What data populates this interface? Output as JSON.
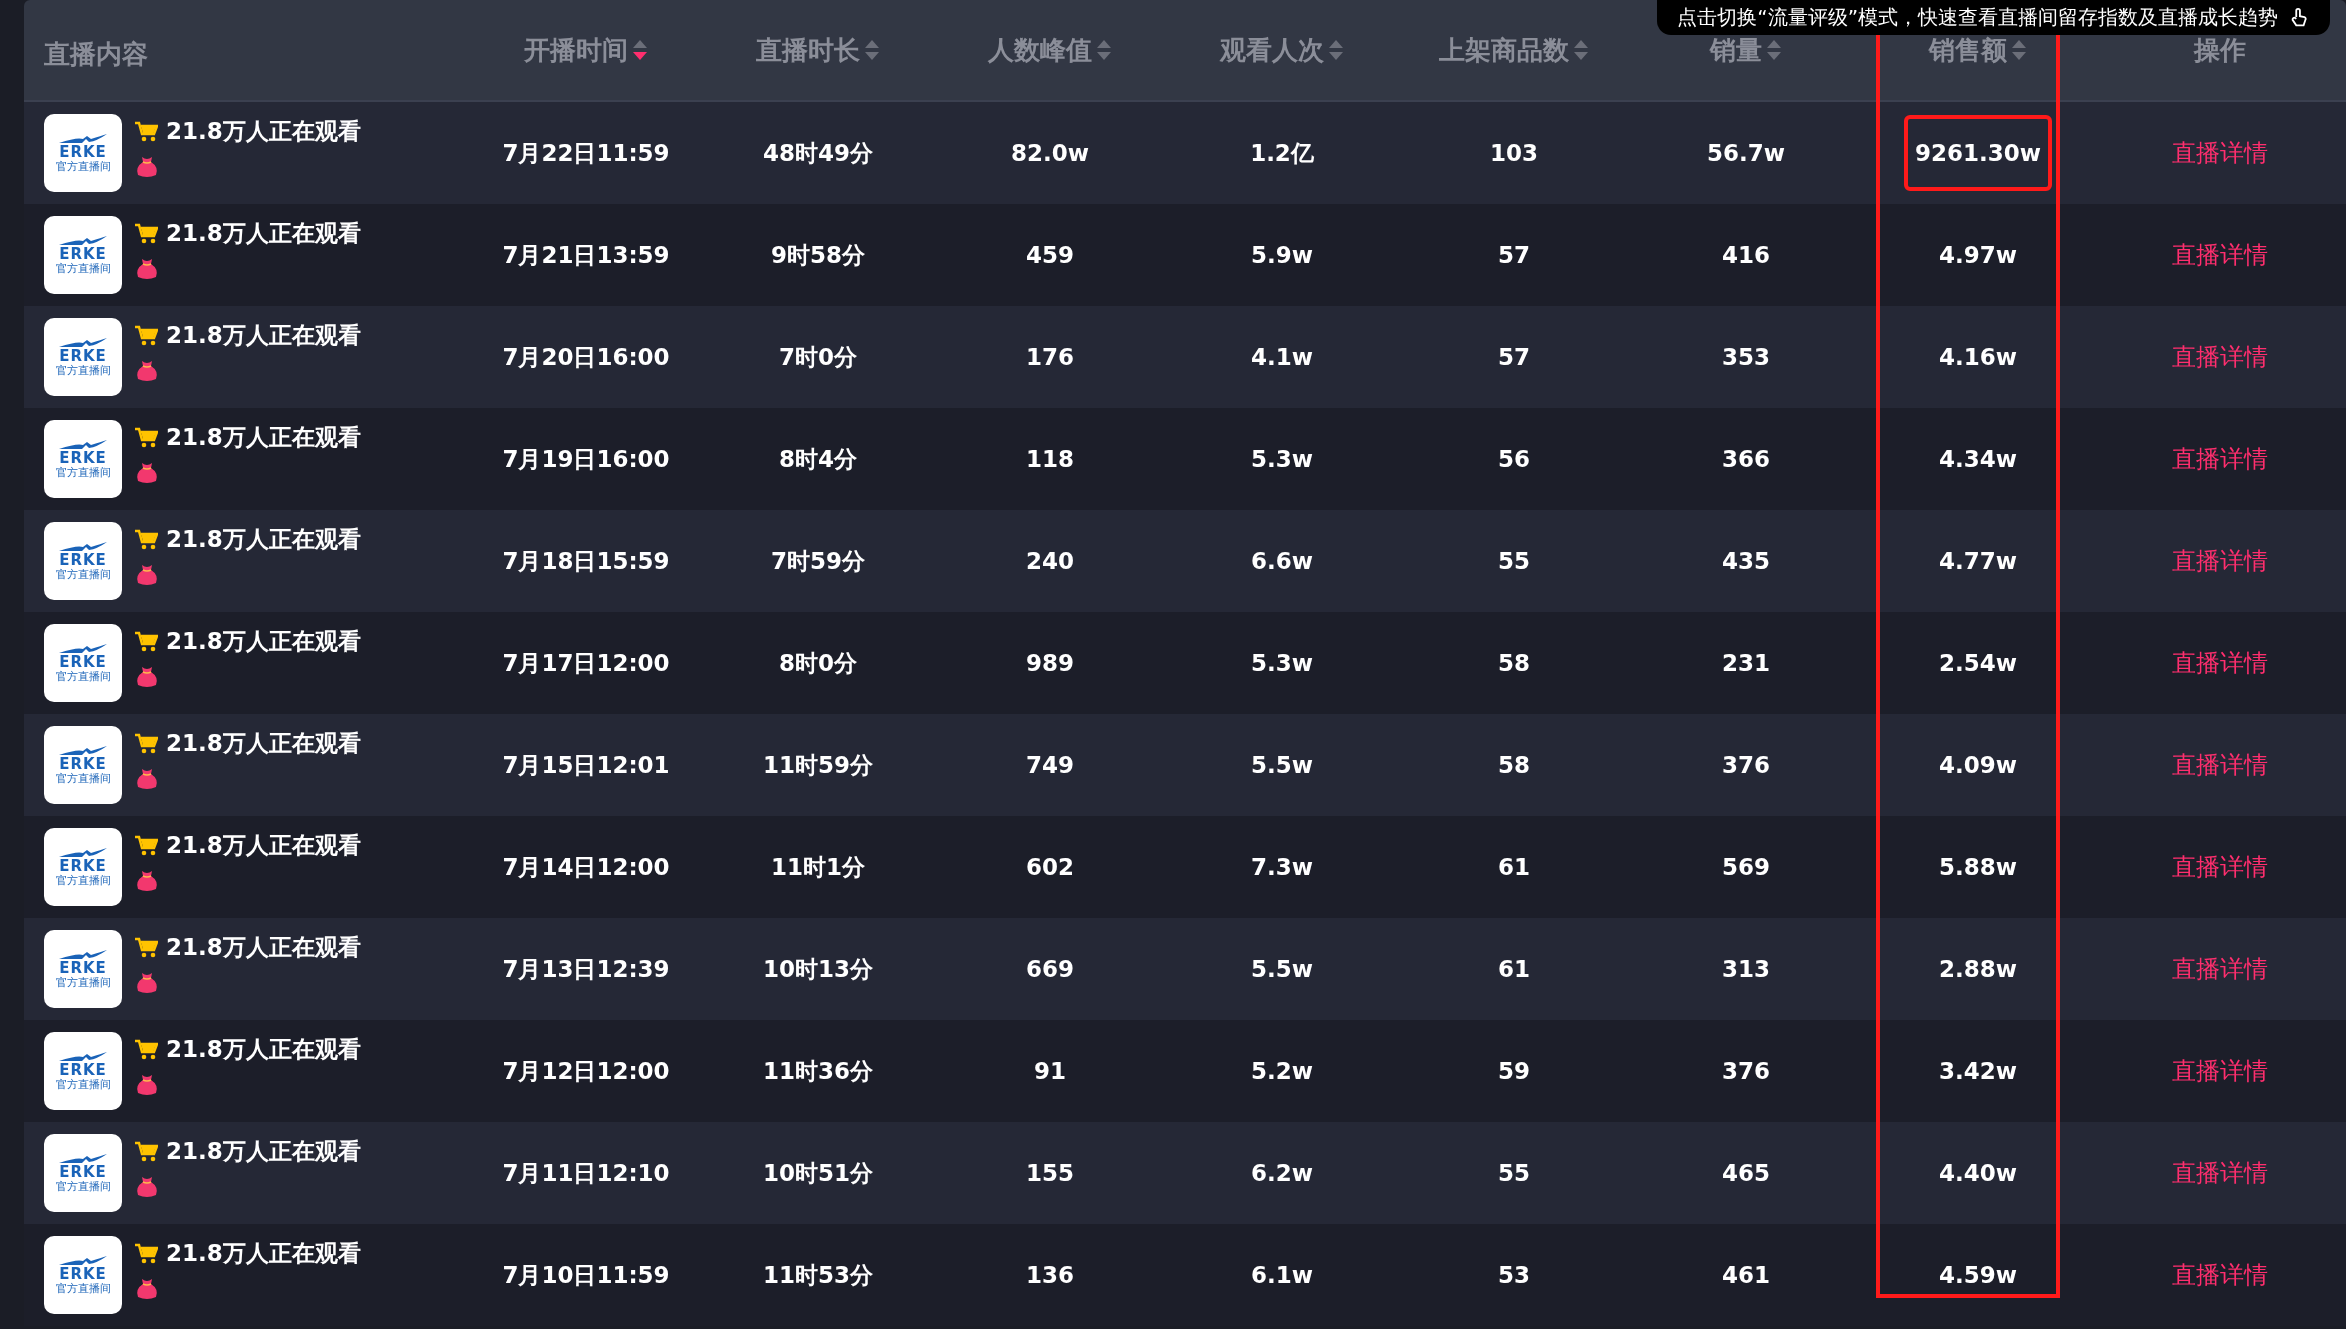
{
  "tooltip": {
    "text": "点击切换“流量评级”模式，快速查看直播间留存指数及直播成长趋势"
  },
  "table": {
    "columns": [
      {
        "label": "直播内容",
        "highlighted": false
      },
      {
        "label": "开播时间",
        "sorted_desc": true,
        "highlighted": false
      },
      {
        "label": "直播时长",
        "sorted_desc": false,
        "highlighted": false
      },
      {
        "label": "人数峰值",
        "sorted_desc": false,
        "highlighted": false
      },
      {
        "label": "观看人次",
        "sorted_desc": false,
        "highlighted": false
      },
      {
        "label": "上架商品数",
        "sorted_desc": false,
        "highlighted": false
      },
      {
        "label": "销量",
        "sorted_desc": false,
        "highlighted": false
      },
      {
        "label": "销售额",
        "sorted_desc": false,
        "highlighted": true
      },
      {
        "label": "操作",
        "highlighted": false
      }
    ],
    "rows": [
      {
        "logo": "ERKE",
        "logo_caption": "官方直播间",
        "highlighted": true,
        "cells": [
          "21.8万人正在观看",
          "7月22日11:59",
          "48时49分",
          "82.0w",
          "1.2亿",
          "103",
          "56.7w",
          "9261.30w",
          "直播详情"
        ]
      },
      {
        "logo": "ERKE",
        "logo_caption": "官方直播间",
        "highlighted": false,
        "cells": [
          "21.8万人正在观看",
          "7月21日13:59",
          "9时58分",
          "459",
          "5.9w",
          "57",
          "416",
          "4.97w",
          "直播详情"
        ]
      },
      {
        "logo": "ERKE",
        "logo_caption": "官方直播间",
        "highlighted": false,
        "cells": [
          "21.8万人正在观看",
          "7月20日16:00",
          "7时0分",
          "176",
          "4.1w",
          "57",
          "353",
          "4.16w",
          "直播详情"
        ]
      },
      {
        "logo": "ERKE",
        "logo_caption": "官方直播间",
        "highlighted": false,
        "cells": [
          "21.8万人正在观看",
          "7月19日16:00",
          "8时4分",
          "118",
          "5.3w",
          "56",
          "366",
          "4.34w",
          "直播详情"
        ]
      },
      {
        "logo": "ERKE",
        "logo_caption": "官方直播间",
        "highlighted": false,
        "cells": [
          "21.8万人正在观看",
          "7月18日15:59",
          "7时59分",
          "240",
          "6.6w",
          "55",
          "435",
          "4.77w",
          "直播详情"
        ]
      },
      {
        "logo": "ERKE",
        "logo_caption": "官方直播间",
        "highlighted": false,
        "cells": [
          "21.8万人正在观看",
          "7月17日12:00",
          "8时0分",
          "989",
          "5.3w",
          "58",
          "231",
          "2.54w",
          "直播详情"
        ]
      },
      {
        "logo": "ERKE",
        "logo_caption": "官方直播间",
        "highlighted": false,
        "cells": [
          "21.8万人正在观看",
          "7月15日12:01",
          "11时59分",
          "749",
          "5.5w",
          "58",
          "376",
          "4.09w",
          "直播详情"
        ]
      },
      {
        "logo": "ERKE",
        "logo_caption": "官方直播间",
        "highlighted": false,
        "cells": [
          "21.8万人正在观看",
          "7月14日12:00",
          "11时1分",
          "602",
          "7.3w",
          "61",
          "569",
          "5.88w",
          "直播详情"
        ]
      },
      {
        "logo": "ERKE",
        "logo_caption": "官方直播间",
        "highlighted": false,
        "cells": [
          "21.8万人正在观看",
          "7月13日12:39",
          "10时13分",
          "669",
          "5.5w",
          "61",
          "313",
          "2.88w",
          "直播详情"
        ]
      },
      {
        "logo": "ERKE",
        "logo_caption": "官方直播间",
        "highlighted": false,
        "cells": [
          "21.8万人正在观看",
          "7月12日12:00",
          "11时36分",
          "91",
          "5.2w",
          "59",
          "376",
          "3.42w",
          "直播详情"
        ]
      },
      {
        "logo": "ERKE",
        "logo_caption": "官方直播间",
        "highlighted": false,
        "cells": [
          "21.8万人正在观看",
          "7月11日12:10",
          "10时51分",
          "155",
          "6.2w",
          "55",
          "465",
          "4.40w",
          "直播详情"
        ]
      },
      {
        "logo": "ERKE",
        "logo_caption": "官方直播间",
        "highlighted": false,
        "cells": [
          "21.8万人正在观看",
          "7月10日11:59",
          "11时53分",
          "136",
          "6.1w",
          "53",
          "461",
          "4.59w",
          "直播详情"
        ]
      }
    ]
  }
}
